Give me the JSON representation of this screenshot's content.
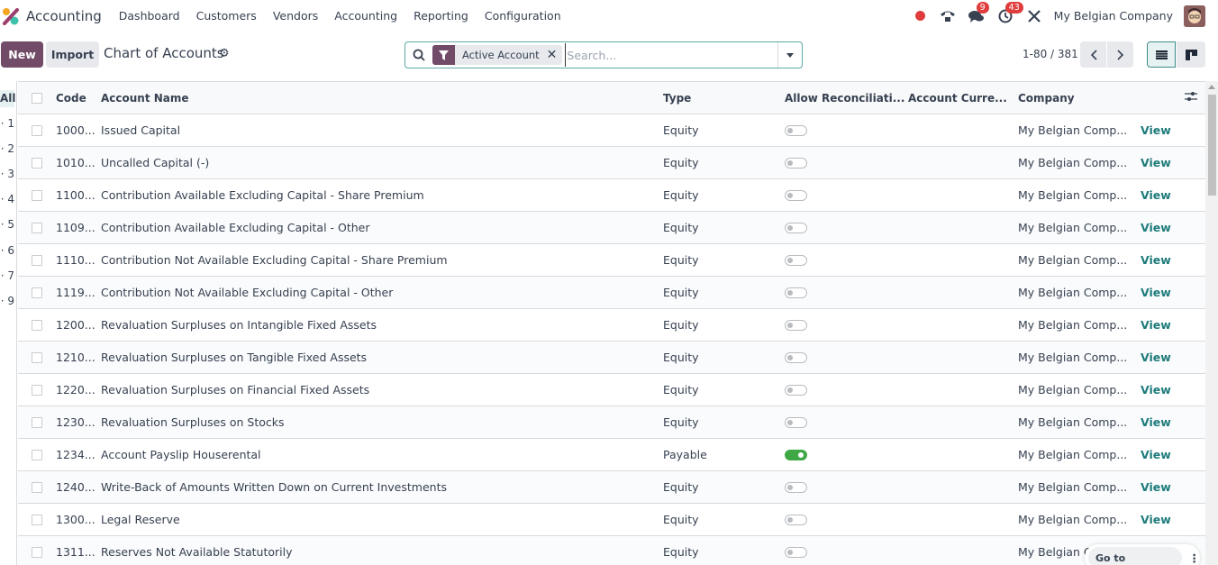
{
  "topnav": {
    "app_title": "Accounting",
    "menu": [
      "Dashboard",
      "Customers",
      "Vendors",
      "Accounting",
      "Reporting",
      "Configuration"
    ],
    "messages_badge": "9",
    "activities_badge": "43",
    "company": "My Belgian Company"
  },
  "control": {
    "new_label": "New",
    "import_label": "Import",
    "title": "Chart of Accounts",
    "search_facet": "Active Account",
    "search_placeholder": "Search...",
    "pager": "1-80 / 381"
  },
  "left_panel": {
    "all_label": "All",
    "items": [
      "1",
      "2",
      "3",
      "4",
      "5",
      "6",
      "7",
      "9"
    ]
  },
  "table": {
    "headers": {
      "code": "Code",
      "name": "Account Name",
      "type": "Type",
      "reconcile": "Allow Reconciliati...",
      "currency": "Account Curre...",
      "company": "Company"
    },
    "view_label": "View",
    "rows": [
      {
        "code": "1000...",
        "name": "Issued Capital",
        "type": "Equity",
        "reconcile": false,
        "company": "My Belgian Comp..."
      },
      {
        "code": "1010...",
        "name": "Uncalled Capital (-)",
        "type": "Equity",
        "reconcile": false,
        "company": "My Belgian Comp..."
      },
      {
        "code": "1100...",
        "name": "Contribution Available Excluding Capital - Share Premium",
        "type": "Equity",
        "reconcile": false,
        "company": "My Belgian Comp..."
      },
      {
        "code": "1109...",
        "name": "Contribution Available Excluding Capital - Other",
        "type": "Equity",
        "reconcile": false,
        "company": "My Belgian Comp..."
      },
      {
        "code": "1110...",
        "name": "Contribution Not Available Excluding Capital - Share Premium",
        "type": "Equity",
        "reconcile": false,
        "company": "My Belgian Comp..."
      },
      {
        "code": "1119...",
        "name": "Contribution Not Available Excluding Capital - Other",
        "type": "Equity",
        "reconcile": false,
        "company": "My Belgian Comp..."
      },
      {
        "code": "1200...",
        "name": "Revaluation Surpluses on Intangible Fixed Assets",
        "type": "Equity",
        "reconcile": false,
        "company": "My Belgian Comp..."
      },
      {
        "code": "1210...",
        "name": "Revaluation Surpluses on Tangible Fixed Assets",
        "type": "Equity",
        "reconcile": false,
        "company": "My Belgian Comp..."
      },
      {
        "code": "1220...",
        "name": "Revaluation Surpluses on Financial Fixed Assets",
        "type": "Equity",
        "reconcile": false,
        "company": "My Belgian Comp..."
      },
      {
        "code": "1230...",
        "name": "Revaluation Surpluses on Stocks",
        "type": "Equity",
        "reconcile": false,
        "company": "My Belgian Comp..."
      },
      {
        "code": "1234...",
        "name": "Account Payslip Houserental",
        "type": "Payable",
        "reconcile": true,
        "company": "My Belgian Comp..."
      },
      {
        "code": "1240...",
        "name": "Write-Back of Amounts Written Down on Current Investments",
        "type": "Equity",
        "reconcile": false,
        "company": "My Belgian Comp..."
      },
      {
        "code": "1300...",
        "name": "Legal Reserve",
        "type": "Equity",
        "reconcile": false,
        "company": "My Belgian Comp..."
      },
      {
        "code": "1311...",
        "name": "Reserves Not Available Statutorily",
        "type": "Equity",
        "reconcile": false,
        "company": "My Belgian C"
      }
    ]
  },
  "frontend": {
    "label": "Go to Frontend"
  }
}
